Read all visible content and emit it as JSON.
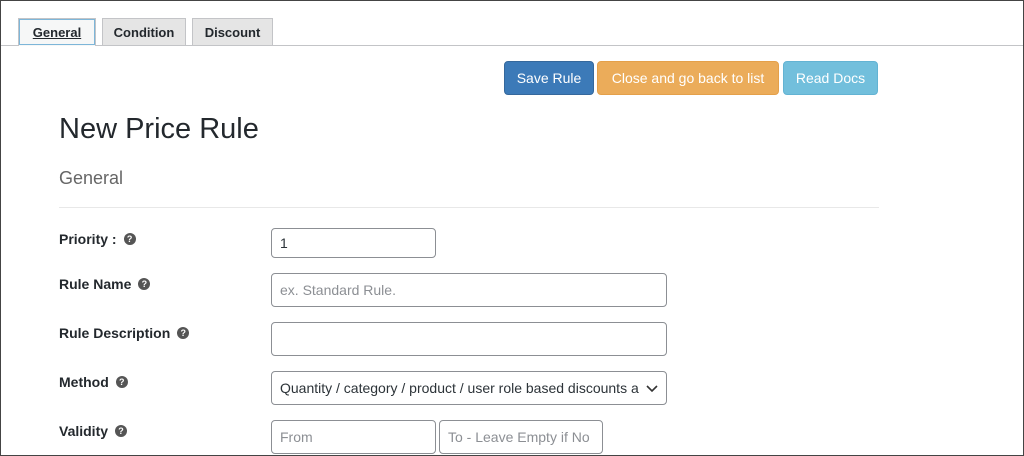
{
  "tabs": [
    {
      "label": "General",
      "active": true
    },
    {
      "label": "Condition",
      "active": false
    },
    {
      "label": "Discount",
      "active": false
    }
  ],
  "toolbar": {
    "save_label": "Save Rule",
    "close_label": "Close and go back to list",
    "docs_label": "Read Docs"
  },
  "page": {
    "title": "New Price Rule",
    "section_title": "General"
  },
  "form": {
    "priority": {
      "label": "Priority :",
      "value": "1"
    },
    "rule_name": {
      "label": "Rule Name",
      "placeholder": "ex. Standard Rule.",
      "value": ""
    },
    "rule_description": {
      "label": "Rule Description",
      "value": ""
    },
    "method": {
      "label": "Method",
      "selected": "Quantity / category / product / user role based discounts a"
    },
    "validity": {
      "label": "Validity",
      "from_placeholder": "From",
      "to_placeholder": "To - Leave Empty if No"
    }
  },
  "icons": {
    "help": "question-circle-icon",
    "dropdown": "chevron-down-icon"
  },
  "colors": {
    "primary": "#3c7ab8",
    "warning": "#ebac5a",
    "info": "#72bfdc"
  }
}
